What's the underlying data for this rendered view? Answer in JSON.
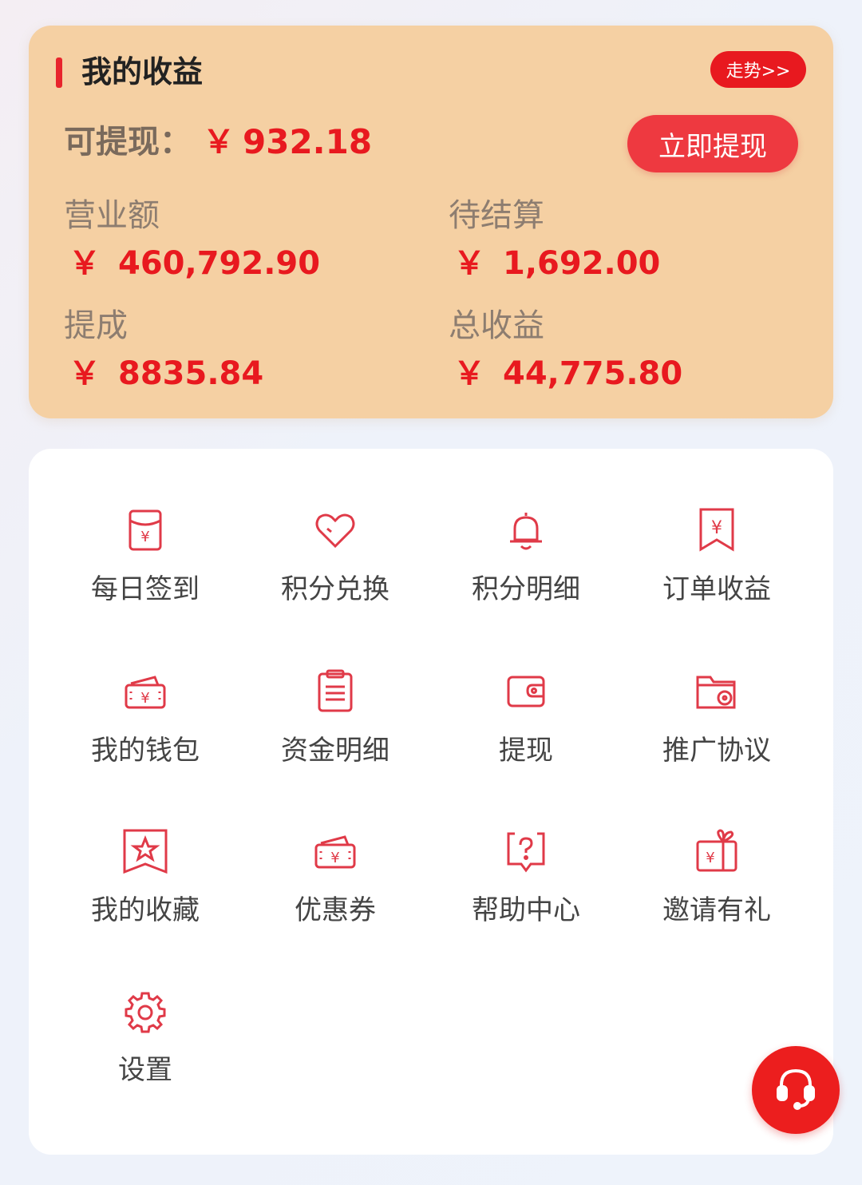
{
  "earnings": {
    "title": "我的收益",
    "trend_label": "走势>>",
    "withdrawable_label": "可提现：",
    "currency": "￥",
    "withdrawable_value": "932.18",
    "withdraw_button": "立即提现",
    "stats": [
      {
        "label": "营业额",
        "value": "460,792.90"
      },
      {
        "label": "待结算",
        "value": "1,692.00"
      },
      {
        "label": "提成",
        "value": "8835.84"
      },
      {
        "label": "总收益",
        "value": "44,775.80"
      }
    ]
  },
  "menu": [
    {
      "label": "每日签到",
      "icon": "red-envelope-icon"
    },
    {
      "label": "积分兑换",
      "icon": "heart-icon"
    },
    {
      "label": "积分明细",
      "icon": "bell-icon"
    },
    {
      "label": "订单收益",
      "icon": "receipt-icon"
    },
    {
      "label": "我的钱包",
      "icon": "wallet-money-icon"
    },
    {
      "label": "资金明细",
      "icon": "clipboard-icon"
    },
    {
      "label": "提现",
      "icon": "wallet-icon"
    },
    {
      "label": "推广协议",
      "icon": "folder-icon"
    },
    {
      "label": "我的收藏",
      "icon": "star-bookmark-icon"
    },
    {
      "label": "优惠券",
      "icon": "coupon-icon"
    },
    {
      "label": "帮助中心",
      "icon": "help-icon"
    },
    {
      "label": "邀请有礼",
      "icon": "gift-icon"
    },
    {
      "label": "设置",
      "icon": "gear-icon"
    }
  ],
  "colors": {
    "accent": "#e8191f",
    "card": "#f5d0a3",
    "icon": "#e03a48"
  }
}
